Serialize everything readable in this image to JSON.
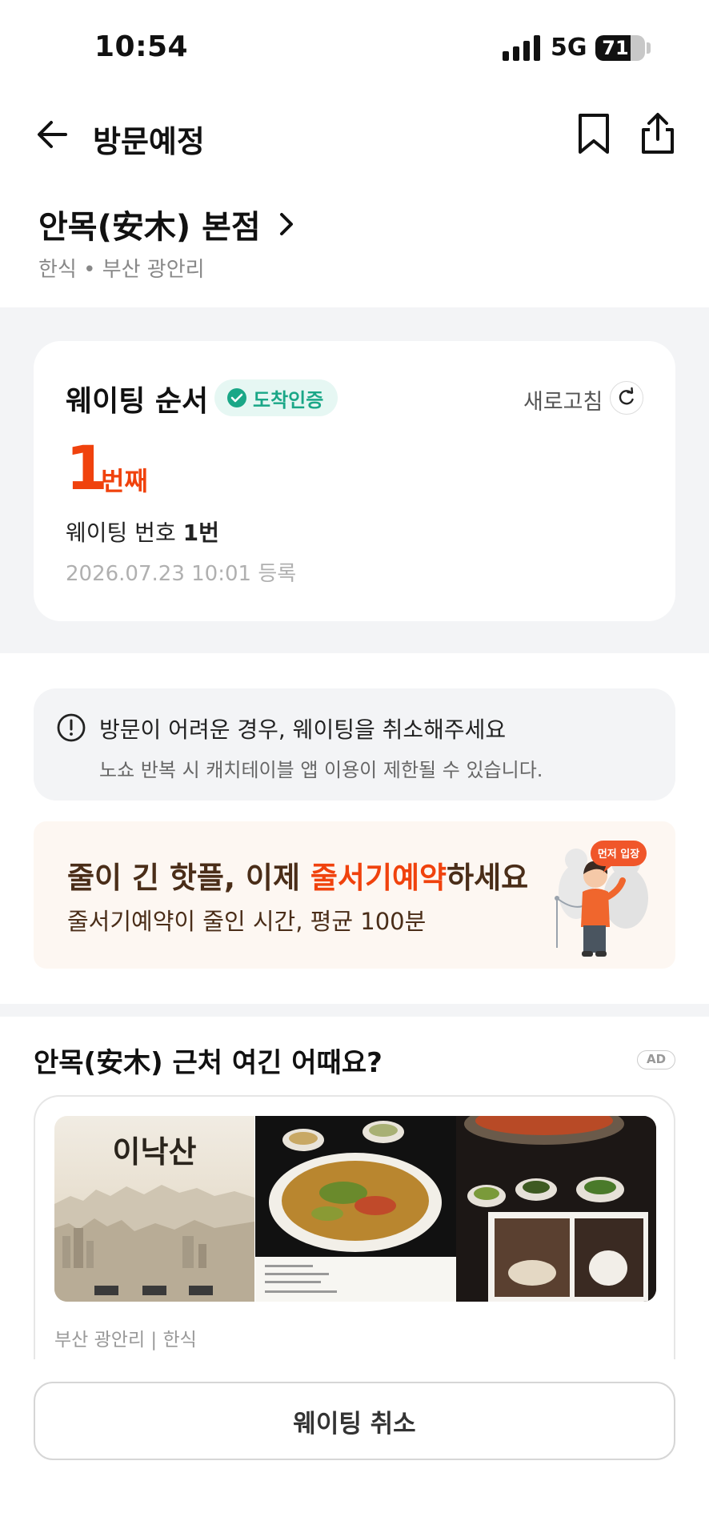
{
  "status_bar": {
    "time": "10:54",
    "network": "5G",
    "battery": "71",
    "battery_level": 0.71
  },
  "header": {
    "title": "방문예정"
  },
  "store": {
    "name": "안목(安木) 본점",
    "meta": "한식 • 부산 광안리"
  },
  "waiting": {
    "title": "웨이팅 순서",
    "arrival_badge": "도착인증",
    "refresh_label": "새로고침",
    "order": "1",
    "order_unit": "번째",
    "number_prefix": "웨이팅 번호 ",
    "number_value": "1번",
    "registered": "2026.07.23 10:01 등록"
  },
  "notice": {
    "title": "방문이 어려운 경우, 웨이팅을 취소해주세요",
    "desc": "노쇼 반복 시 캐치테이블 앱 이용이 제한될 수 있습니다."
  },
  "promo": {
    "title_pre": "줄이 긴 핫플, 이제 ",
    "title_highlight": "줄서기예약",
    "title_post": "하세요",
    "subtitle": "줄서기예약이 줄인 시간, 평균 100분",
    "bubble": "먼저 입장"
  },
  "nearby": {
    "title": "안목(安木) 근처 여긴 어때요?",
    "ad_label": "AD",
    "card_meta": "부산 광안리 | 한식",
    "photo_sign": "이낙산"
  },
  "bottom": {
    "cancel_label": "웨이팅 취소"
  },
  "colors": {
    "accent": "#f0420d",
    "teal": "#1aa787",
    "promo_text": "#4a2d18",
    "section_bg": "#f3f4f6"
  }
}
